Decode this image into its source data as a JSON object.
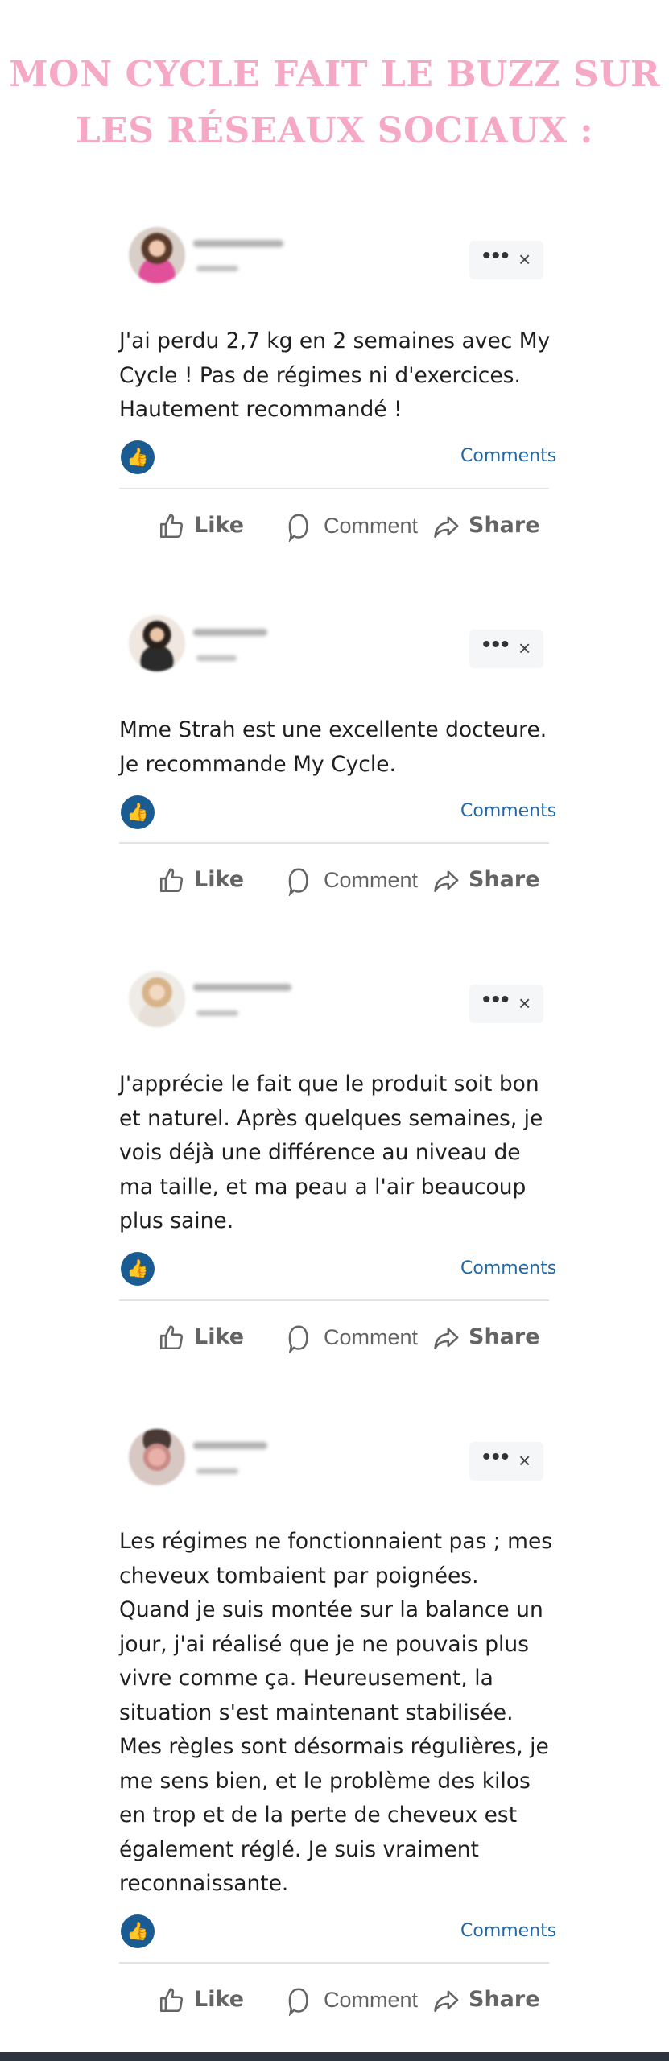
{
  "title": "MON CYCLE FAIT LE BUZZ SUR LES RÉSEAUX SOCIAUX :",
  "colors": {
    "title": "#f6a9c6",
    "like_badge": "#1a5c92",
    "link": "#2268a6",
    "footer": "#2e3540"
  },
  "labels": {
    "more_options": "•••",
    "close": "×",
    "comments_link": "Comments",
    "like": "Like",
    "comment": "Comment",
    "share": "Share"
  },
  "posts": [
    {
      "text": "J'ai perdu 2,7 kg en 2 semaines avec My Cycle ! Pas de régimes ni d'exercices. Hautement recommandé !"
    },
    {
      "text": "Mme Strah est une excellente docteure. Je recommande My Cycle."
    },
    {
      "text": "J'apprécie le fait que le produit soit bon et naturel. Après quelques semaines, je vois déjà une différence au niveau de ma taille, et ma peau a l'air beaucoup plus saine."
    },
    {
      "text": "Les régimes ne fonctionnaient pas ; mes cheveux tombaient par poignées. Quand je suis montée sur la balance un jour, j'ai réalisé que je ne pouvais plus vivre comme ça. Heureusement, la situation s'est maintenant stabilisée. Mes règles sont désormais régulières, je me sens bien, et le problème des kilos en trop et de la perte de cheveux est également réglé. Je suis vraiment reconnaissante."
    }
  ]
}
